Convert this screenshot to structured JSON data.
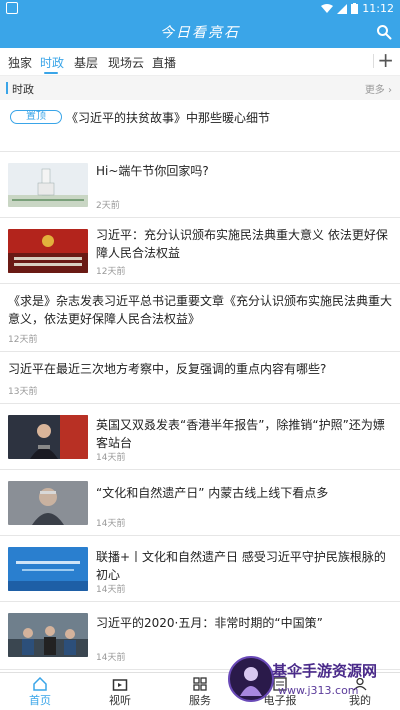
{
  "status_bar": {
    "time": "11:12"
  },
  "app": {
    "title": "今日看亮石"
  },
  "tabs": [
    "独家",
    "时政",
    "基层",
    "现场云",
    "直播"
  ],
  "active_tab": "时政",
  "section": {
    "label": "时政",
    "more": "更多"
  },
  "pinned": {
    "badge": "置顶",
    "title": "《习近平的扶贫故事》中那些暖心细节"
  },
  "news": [
    {
      "title": "Hi~端午节你回家吗?",
      "time": "2天前",
      "thumb": "building-photo"
    },
    {
      "title": "习近平：充分认识颁布实施民法典重大意义 依法更好保障人民合法权益",
      "time": "12天前",
      "thumb": "congress-hall-photo"
    },
    {
      "title": "《求是》杂志发表习近平总书记重要文章《充分认识颁布实施民法典重大意义，依法更好保障人民合法权益》",
      "time": "12天前",
      "thumb": null
    },
    {
      "title": "习近平在最近三次地方考察中，反复强调的重点内容有哪些?",
      "time": "13天前",
      "thumb": null
    },
    {
      "title": "英国又双叒发表“香港半年报告”，除推销“护照”还为嫖客站台",
      "time": "14天前",
      "thumb": "spokesperson-photo"
    },
    {
      "title": "“文化和自然遗产日” 内蒙古线上线下看点多",
      "time": "14天前",
      "thumb": "elder-portrait-photo"
    },
    {
      "title": "联播+丨文化和自然遗产日 感受习近平守护民族根脉的初心",
      "time": "14天前",
      "thumb": "blue-banner-photo"
    },
    {
      "title": "习近平的2020·五月：非常时期的“中国策”",
      "time": "14天前",
      "thumb": "factory-visit-photo"
    }
  ],
  "bottom_nav": [
    {
      "label": "首页",
      "icon": "home-icon",
      "active": true
    },
    {
      "label": "视听",
      "icon": "tv-icon",
      "active": false
    },
    {
      "label": "服务",
      "icon": "grid-icon",
      "active": false
    },
    {
      "label": "电子报",
      "icon": "newspaper-icon",
      "active": false
    },
    {
      "label": "我的",
      "icon": "user-icon",
      "active": false
    }
  ],
  "watermark": {
    "name": "基伞手游资源网",
    "url": "www.j313.com"
  },
  "colors": {
    "accent": "#3aa5e8",
    "background": "#ffffff",
    "divider": "#e6e6e6"
  }
}
